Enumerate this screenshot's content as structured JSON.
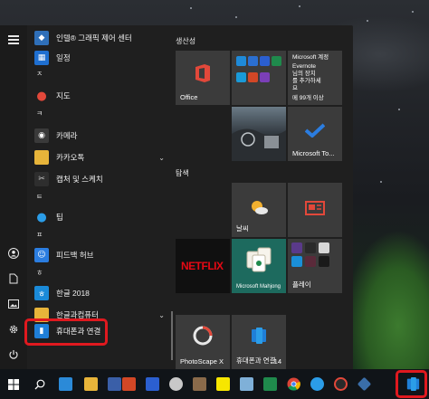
{
  "app_list": {
    "items": [
      {
        "label": "인텔® 그래픽 제어 센터",
        "icon": "intel-graphics-icon",
        "color": "#2f6fb8"
      },
      {
        "label": "일정",
        "icon": "calendar-icon",
        "color": "#1f6fd0"
      },
      {
        "label": "ㅈ",
        "type": "letter"
      },
      {
        "label": "지도",
        "icon": "maps-icon",
        "color": "#d63b2e"
      },
      {
        "label": "ㅋ",
        "type": "letter"
      },
      {
        "label": "카메라",
        "icon": "camera-icon",
        "color": "#3a3a3a"
      },
      {
        "label": "카카오톡",
        "icon": "folder-icon",
        "color": "#e7b43a",
        "expandable": true
      },
      {
        "label": "캡처 및 스케치",
        "icon": "snip-sketch-icon",
        "color": "#2e2e2e"
      },
      {
        "label": "ㅌ",
        "type": "letter"
      },
      {
        "label": "팁",
        "icon": "tips-icon",
        "color": "#2b7de0"
      },
      {
        "label": "ㅍ",
        "type": "letter"
      },
      {
        "label": "피드백 허브",
        "icon": "feedback-hub-icon",
        "color": "#2b7de0"
      },
      {
        "label": "ㅎ",
        "type": "letter"
      },
      {
        "label": "한글 2018",
        "icon": "hangul-icon",
        "color": "#1a8ad8"
      },
      {
        "label": "한글과컴퓨터",
        "icon": "folder-icon",
        "color": "#e7b43a",
        "expandable": true
      },
      {
        "label": "휴대폰과 연결",
        "icon": "your-phone-icon",
        "color": "#1f7fd8"
      }
    ]
  },
  "tiles": {
    "group_productivity": "생산성",
    "group_explore": "탐색",
    "office": "Office",
    "mail_tile_line1": "Microsoft 계정",
    "mail_tile_line2": "Evernote",
    "mail_tile_line3": "님의 장치",
    "mail_tile_line4": "를 추가하세",
    "mail_tile_line5": "요",
    "mail_count": "메 99개 이상",
    "microsoft_todo": "Microsoft To...",
    "weather": "날씨",
    "netflix": "NETFLIX",
    "mahjong": "Microsoft Mahjong",
    "play": "플레이",
    "photoscape": "PhotoScape X",
    "your_phone": "휴대폰과 연결",
    "your_phone_badge": "14"
  },
  "taskbar": {
    "icons": [
      "windows-start-icon",
      "search-icon",
      "task-view-icon",
      "3d-box-icon",
      "file-explorer-icon",
      "box-app-icon",
      "powerpoint-icon",
      "word-icon",
      "photo-app-icon",
      "kakaotalk-icon",
      "notepad-icon",
      "excel-icon",
      "chrome-icon",
      "edge-icon",
      "photoscape-icon",
      "network-app-icon",
      "your-phone-icon"
    ]
  },
  "colors": {
    "accent_blue": "#2b7de0",
    "highlight_red": "#e0191f",
    "menu_bg": "#1f1f1f",
    "tile_bg": "#3a3a3a"
  }
}
